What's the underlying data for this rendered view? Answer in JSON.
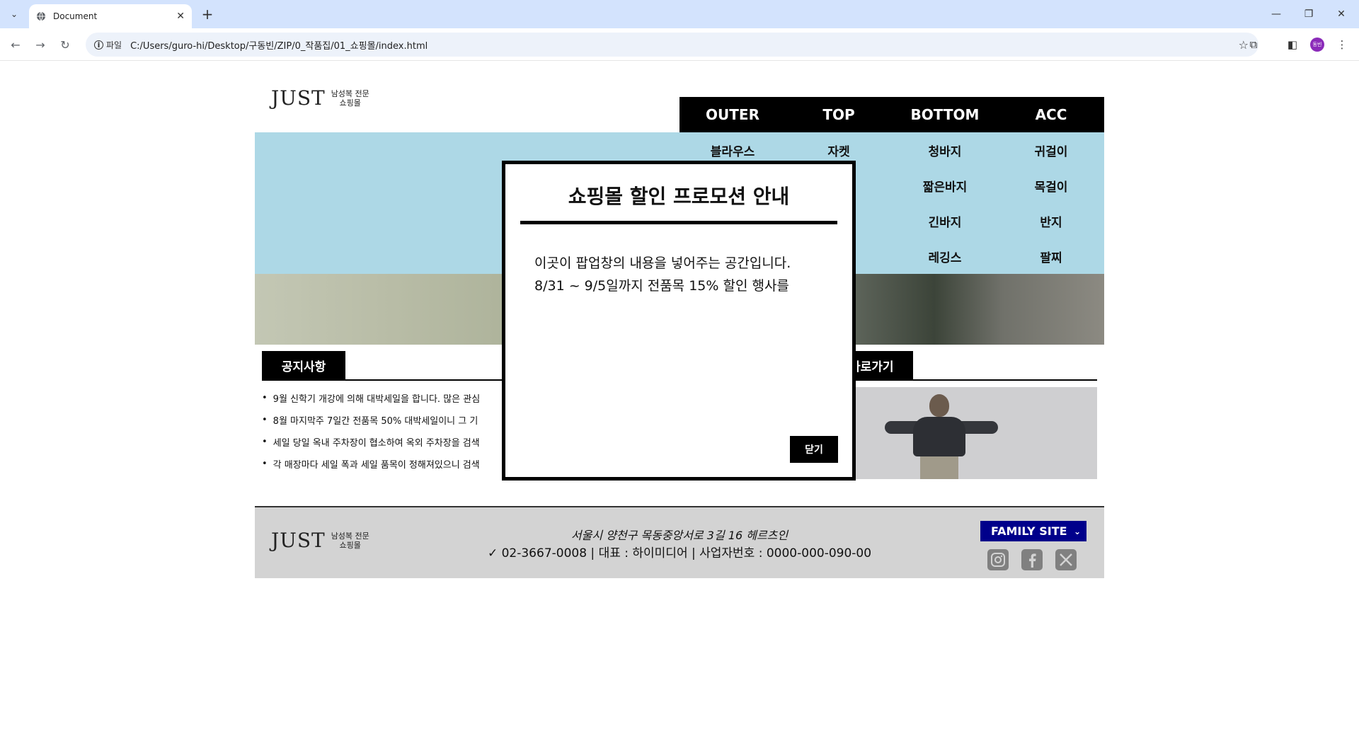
{
  "browser": {
    "tab_title": "Document",
    "scheme_label": "파일",
    "url": "C:/Users/guro-hi/Desktop/구동빈/ZIP/0_작품집/01_쇼핑몰/index.html",
    "avatar_text": "동빈"
  },
  "logo": {
    "word": "JUST",
    "sub_line1": "남성복 전문",
    "sub_line2": "쇼핑몰"
  },
  "nav": {
    "menus": [
      {
        "label": "OUTER",
        "items": [
          "블라우스"
        ]
      },
      {
        "label": "TOP",
        "items": [
          "자켓"
        ]
      },
      {
        "label": "BOTTOM",
        "items": [
          "청바지",
          "짧은바지",
          "긴바지",
          "레깅스"
        ]
      },
      {
        "label": "ACC",
        "items": [
          "귀걸이",
          "목걸이",
          "반지",
          "팔찌"
        ]
      }
    ]
  },
  "notice": {
    "title": "공지사항",
    "items": [
      "9월 신학기 개강에 의해 대박세일을 합니다. 많은 관심",
      "8월 마지막주 7일간 전품목 50% 대박세일이니 그 기",
      "세일 당일 옥내 주차장이 협소하여 옥외 주차장을 검색",
      "각 매장마다 세일 폭과 세일 품목이 정해져있으니 검색"
    ]
  },
  "shortcut": {
    "title": "바로가기"
  },
  "footer": {
    "address": "서울시 양천구 목동중앙서로 3길 16 헤르츠인",
    "info": "✓ 02-3667-0008 | 대표 : 하이미디어 | 사업자번호 : 0000-000-090-00",
    "family_site": "FAMILY SITE"
  },
  "popup": {
    "title": "쇼핑몰 할인 프로모션 안내",
    "line1": "이곳이 팝업창의 내용을 넣어주는 공간입니다.",
    "line2": "8/31 ~ 9/5일까지 전품목 15% 할인 행사를",
    "close_label": "닫기"
  },
  "colors": {
    "banner_bg": "#add8e6",
    "nav_bg": "#000000",
    "footer_bg": "#d3d3d3",
    "family_bg": "#00008b"
  }
}
